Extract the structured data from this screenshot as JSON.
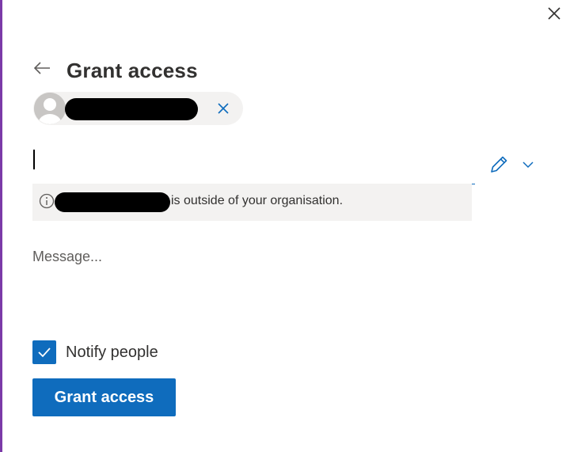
{
  "dialog": {
    "title": "Grant access",
    "close_icon": "close-icon",
    "back_icon": "arrow-left-icon"
  },
  "recipient": {
    "chip_avatar_icon": "person-avatar-icon",
    "chip_remove_icon": "close-icon",
    "input_value": "",
    "permission_icon": "pencil-icon",
    "permission_dropdown_icon": "chevron-down-icon"
  },
  "notice": {
    "icon": "info-icon",
    "text": "is outside of your organisation."
  },
  "message": {
    "placeholder": "Message...",
    "value": ""
  },
  "notify": {
    "label": "Notify people",
    "checked": true
  },
  "actions": {
    "grant_label": "Grant access"
  },
  "colors": {
    "accent": "#0f6cbd",
    "notice_bg": "#f3f2f1",
    "window_border": "#7b3aa8"
  }
}
